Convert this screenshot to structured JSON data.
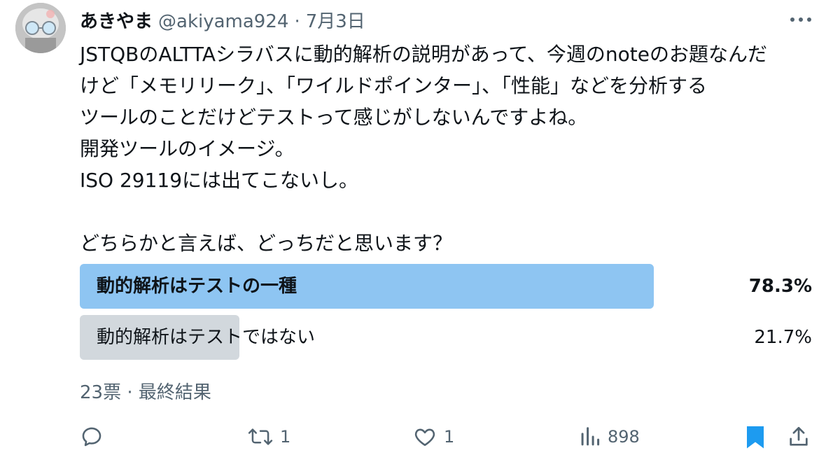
{
  "tweet": {
    "author": {
      "display_name": "あきやま",
      "handle": "@akiyama924"
    },
    "separator": "·",
    "date": "7月3日",
    "text_lines": [
      "JSTQBのALTTAシラバスに動的解析の説明があって、今週のnoteのお題なんだ",
      "けど「メモリリーク」、「ワイルドポインター」、「性能」などを分析する",
      "ツールのことだけどテストって感じがしないんですよね。",
      "開発ツールのイメージ。",
      "ISO 29119には出てこないし。",
      "",
      "どちらかと言えば、どっちだと思います？"
    ]
  },
  "poll": {
    "options": [
      {
        "label": "動的解析はテストの一種",
        "percent_text": "78.3%",
        "percent": 78.3,
        "winner": true,
        "bar_color": "#8ec5f2"
      },
      {
        "label": "動的解析はテストではない",
        "percent_text": "21.7%",
        "percent": 21.7,
        "winner": false,
        "bar_color": "#d2d8dd"
      }
    ],
    "votes_text": "23票",
    "separator": "·",
    "status_text": "最終結果"
  },
  "actions": {
    "reply": {
      "icon": "reply-icon",
      "count": ""
    },
    "retweet": {
      "icon": "retweet-icon",
      "count": "1"
    },
    "like": {
      "icon": "heart-icon",
      "count": "1"
    },
    "views": {
      "icon": "views-icon",
      "count": "898"
    },
    "bookmark": {
      "icon": "bookmark-icon",
      "count": ""
    },
    "share": {
      "icon": "share-icon",
      "count": ""
    }
  },
  "colors": {
    "text": "#0f1419",
    "secondary": "#536471",
    "accent": "#1d9bf0",
    "poll_winner_bar": "#8ec5f2",
    "poll_other_bar": "#d2d8dd"
  }
}
